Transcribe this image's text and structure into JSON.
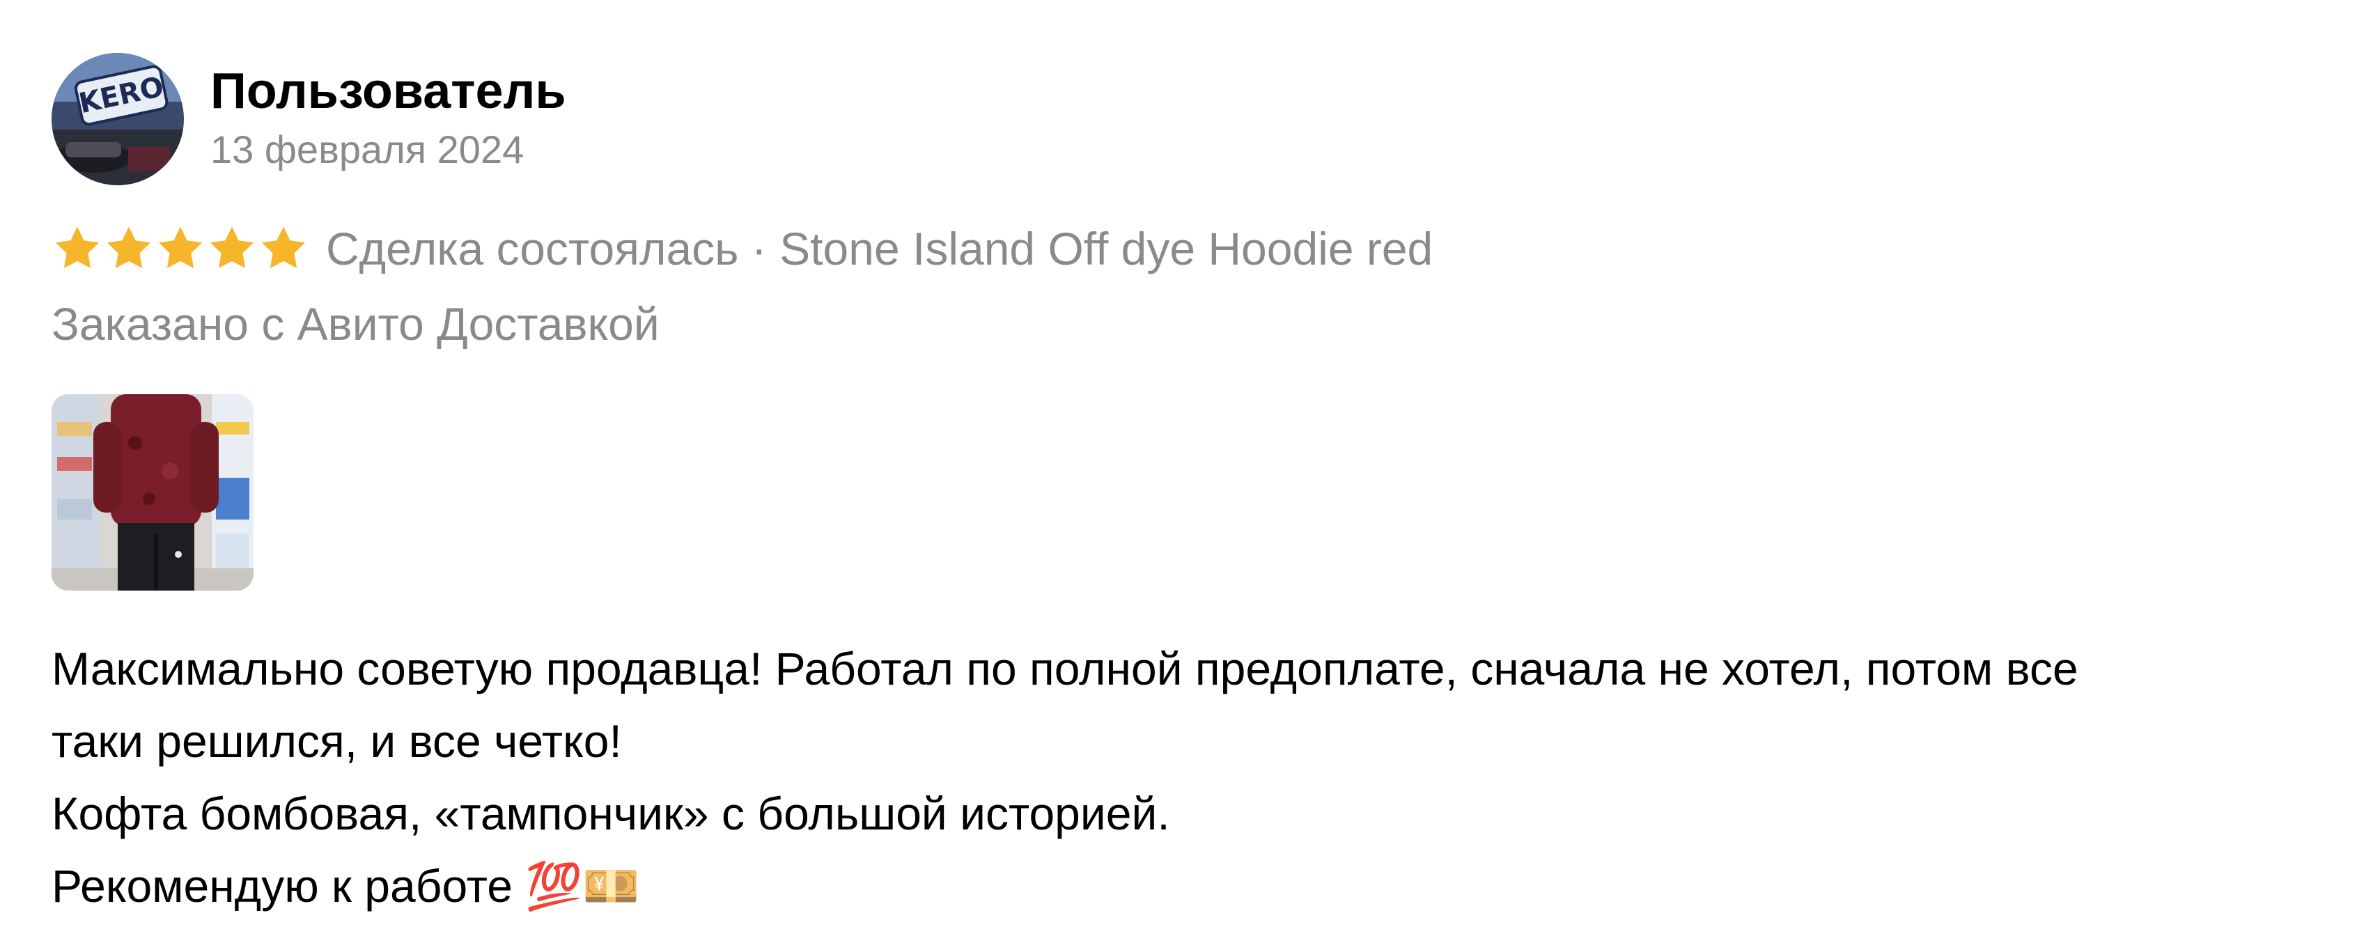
{
  "review": {
    "user_name": "Пользователь",
    "date": "13 февраля 2024",
    "rating": 5,
    "rating_max": 5,
    "star_color": "#f7b52c",
    "deal_line": "Сделка состоялась · Stone Island Off dye Hoodie red",
    "delivery": "Заказано с Авито Доставкой",
    "avatar_text": "KERO",
    "text_lines": [
      "Максимально советую продавца! Работал по полной предоплате, сначала не хотел, потом все",
      "таки решился, и все четко!",
      "Кофта бомбовая, «тампончик» с большой историей.",
      "Рекомендую к работе 💯💴"
    ]
  }
}
